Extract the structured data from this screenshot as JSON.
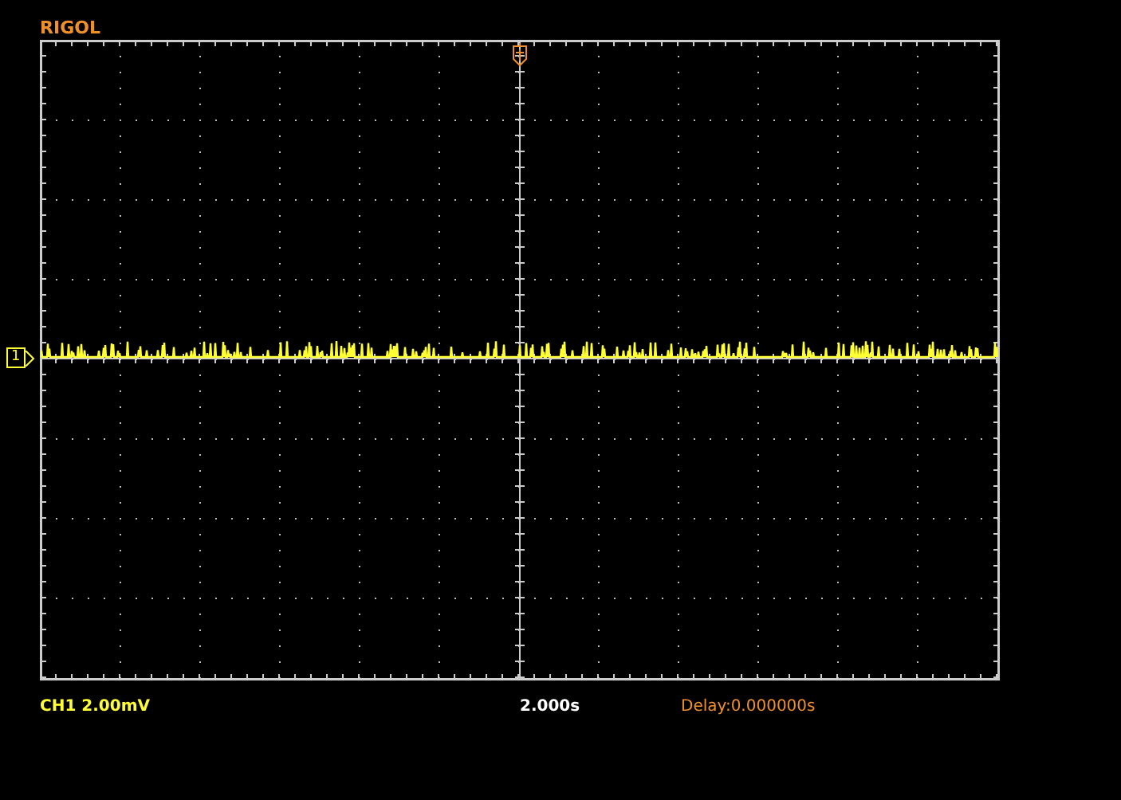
{
  "logo": "RIGOL",
  "channel_marker": "1",
  "status_bar": {
    "channel_scale": "CH1 2.00mV",
    "timebase": "2.000s",
    "delay": "Delay:0.000000s"
  }
}
